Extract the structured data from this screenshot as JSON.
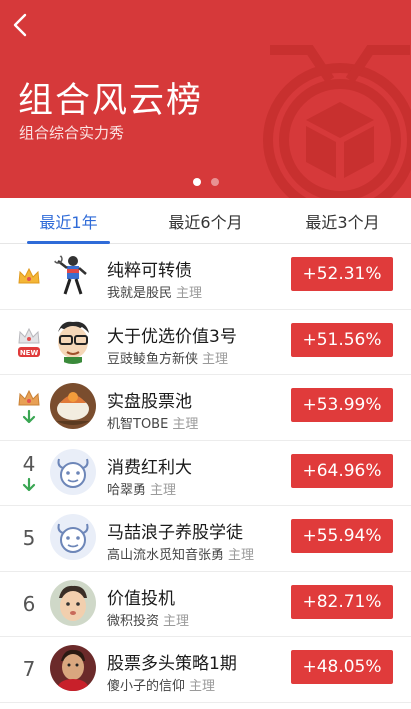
{
  "header": {
    "title": "组合风云榜",
    "subtitle": "组合综合实力秀"
  },
  "tabs": [
    {
      "label": "最近1年",
      "active": true
    },
    {
      "label": "最近6个月",
      "active": false
    },
    {
      "label": "最近3个月",
      "active": false
    }
  ],
  "ranking": [
    {
      "rank": "1",
      "badge": "gold-crown",
      "trend": "none",
      "name": "纯粹可转债",
      "owner": "我就是股民",
      "role": "主理",
      "return": "+52.31%"
    },
    {
      "rank": "2",
      "badge": "silver-crown",
      "trend": "new",
      "new_label": "NEW",
      "name": "大于优选价值3号",
      "owner": "豆豉鲮鱼方新侠",
      "role": "主理",
      "return": "+51.56%"
    },
    {
      "rank": "3",
      "badge": "bronze-crown",
      "trend": "down",
      "name": "实盘股票池",
      "owner": "机智TOBE",
      "role": "主理",
      "return": "+53.99%"
    },
    {
      "rank": "4",
      "badge": "none",
      "trend": "down",
      "name": "消费红利大",
      "owner": "哈翠勇",
      "role": "主理",
      "return": "+64.96%"
    },
    {
      "rank": "5",
      "badge": "none",
      "trend": "none",
      "name": "马喆浪子养股学徒",
      "owner": "高山流水觅知音张勇",
      "role": "主理",
      "return": "+55.94%"
    },
    {
      "rank": "6",
      "badge": "none",
      "trend": "none",
      "name": "价值投机",
      "owner": "微积投资",
      "role": "主理",
      "return": "+82.71%"
    },
    {
      "rank": "7",
      "badge": "none",
      "trend": "none",
      "name": "股票多头策略1期",
      "owner": "傻小子的信仰",
      "role": "主理",
      "return": "+48.05%"
    }
  ],
  "colors": {
    "banner": "#d6393a",
    "active_tab": "#2f6bd8",
    "return_badge": "#e03b3b",
    "down_arrow": "#3aa653"
  }
}
